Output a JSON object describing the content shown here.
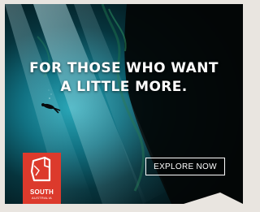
{
  "ad": {
    "headline_line1": "FOR THOSE WHO WANT",
    "headline_line2": "A LITTLE MORE.",
    "cta_label": "EXPLORE NOW",
    "logo_line1": "SOUTH",
    "logo_line2": "AUSTRALIA"
  },
  "colors": {
    "brand_red": "#dc3a2c",
    "water_teal": "#1f8fa3",
    "page_bg": "#e9e5e0"
  },
  "icons": [
    "scuba-diver-icon",
    "south-australia-logo-icon"
  ]
}
